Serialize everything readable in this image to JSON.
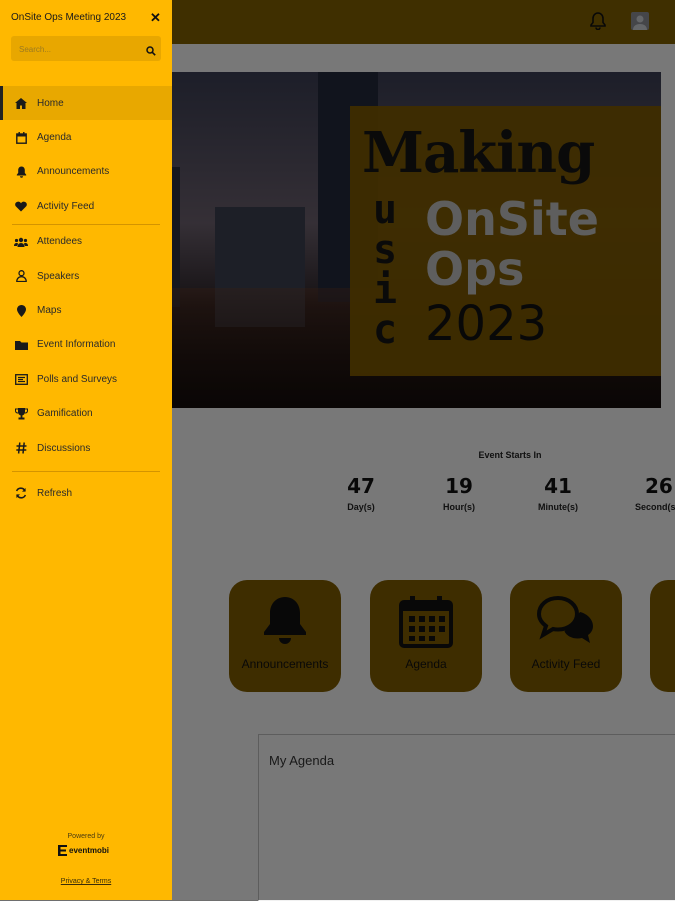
{
  "app": {
    "title": "OnSite Ops Meeting 2023"
  },
  "search": {
    "placeholder": "Search..."
  },
  "menu": {
    "items": [
      {
        "label": "Home",
        "icon": "home-icon",
        "active": true
      },
      {
        "label": "Agenda",
        "icon": "calendar-icon"
      },
      {
        "label": "Announcements",
        "icon": "bell-icon"
      },
      {
        "label": "Activity Feed",
        "icon": "heart-icon"
      },
      {
        "label": "Attendees",
        "icon": "users-icon"
      },
      {
        "label": "Speakers",
        "icon": "person-icon"
      },
      {
        "label": "Maps",
        "icon": "map-pin-icon"
      },
      {
        "label": "Event Information",
        "icon": "folder-icon"
      },
      {
        "label": "Polls and Surveys",
        "icon": "poll-icon"
      },
      {
        "label": "Gamification",
        "icon": "trophy-icon"
      },
      {
        "label": "Discussions",
        "icon": "hashtag-icon"
      },
      {
        "label": "Refresh",
        "icon": "refresh-icon"
      }
    ]
  },
  "footer": {
    "powered_by": "Powered by",
    "brand": "eventmobi",
    "privacy": "Privacy & Terms"
  },
  "banner": {
    "line1": "Making",
    "vertical": [
      "u",
      "s",
      "i",
      "c"
    ],
    "line2": "OnSite",
    "line3": "Ops",
    "line4": "2023"
  },
  "countdown": {
    "title": "Event Starts In",
    "units": [
      {
        "value": "47",
        "label": "Day(s)"
      },
      {
        "value": "19",
        "label": "Hour(s)"
      },
      {
        "value": "41",
        "label": "Minute(s)"
      },
      {
        "value": "26",
        "label": "Second(s)"
      }
    ]
  },
  "tiles": [
    {
      "label": "Announcements",
      "icon": "bell-icon"
    },
    {
      "label": "Agenda",
      "icon": "calendar-icon"
    },
    {
      "label": "Activity Feed",
      "icon": "chat-bubbles-icon"
    }
  ],
  "agenda": {
    "heading": "My Agenda"
  },
  "colors": {
    "drawer": "#ffb800",
    "accent": "#7d5a00"
  }
}
